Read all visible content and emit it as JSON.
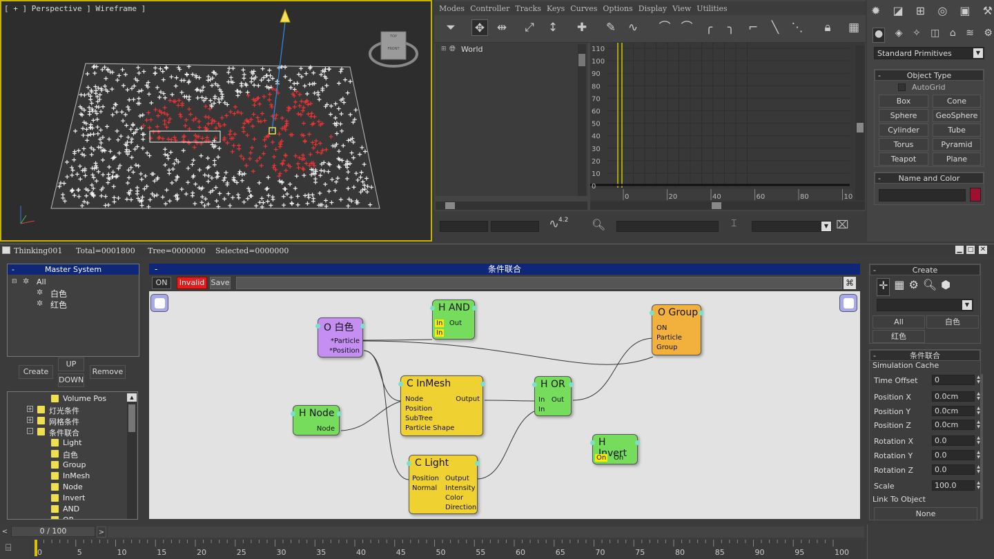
{
  "viewport": {
    "label": "[ + ] Perspective ] Wireframe ]",
    "viewcube_top": "TOP",
    "viewcube_front": "FRONT"
  },
  "trackview": {
    "menu": [
      "Modes",
      "Controller",
      "Tracks",
      "Keys",
      "Curves",
      "Options",
      "Display",
      "View",
      "Utilities"
    ],
    "tree_root": "World",
    "y_ticks": [
      "110",
      "100",
      "90",
      "80",
      "70",
      "60",
      "50",
      "40",
      "30",
      "20",
      "10",
      "0"
    ],
    "x_ticks": [
      "0",
      "20",
      "40",
      "60",
      "80",
      "10"
    ],
    "curve_badge": "4.2"
  },
  "cmdpanel": {
    "dropdown": "Standard Primitives",
    "object_type_title": "Object Type",
    "autogrid": "AutoGrid",
    "buttons": [
      "Box",
      "Cone",
      "Sphere",
      "GeoSphere",
      "Cylinder",
      "Tube",
      "Torus",
      "Pyramid",
      "Teapot",
      "Plane"
    ],
    "name_color_title": "Name and Color",
    "swatch_color": "#9e1030"
  },
  "thinking": {
    "title": "Thinking001",
    "total": "Total=0001800",
    "tree": "Tree=0000000",
    "selected": "Selected=0000000"
  },
  "master": {
    "title": "Master System",
    "items": [
      "All",
      "白色",
      "红色"
    ],
    "create": "Create",
    "up": "UP",
    "down": "DOWN",
    "remove": "Remove"
  },
  "master_tree": {
    "items": [
      {
        "label": "Volume Pos",
        "level": 2
      },
      {
        "label": "灯光条件",
        "level": 1,
        "toggle": "+"
      },
      {
        "label": "网格条件",
        "level": 1,
        "toggle": "+"
      },
      {
        "label": "条件联合",
        "level": 1,
        "toggle": "-"
      },
      {
        "label": "Light",
        "level": 2
      },
      {
        "label": "白色",
        "level": 2
      },
      {
        "label": "Group",
        "level": 2
      },
      {
        "label": "InMesh",
        "level": 2
      },
      {
        "label": "Node",
        "level": 2
      },
      {
        "label": "Invert",
        "level": 2
      },
      {
        "label": "AND",
        "level": 2
      },
      {
        "label": "OR",
        "level": 2
      }
    ]
  },
  "canvas": {
    "title": "条件联合",
    "on_label": "ON",
    "invalid_label": "Invalid",
    "save_label": "Save",
    "nodes": {
      "white": {
        "title": "O 白色",
        "ports": [
          "*Particle",
          "*Position"
        ]
      },
      "and": {
        "title": "H AND",
        "in1": "In",
        "in2": "In",
        "out": "Out"
      },
      "group": {
        "title": "O Group",
        "ports": [
          "ON",
          "Particle",
          "Group"
        ]
      },
      "inmesh": {
        "title": "C InMesh",
        "ports": [
          "Node",
          "Position",
          "SubTree",
          "Particle Shape"
        ],
        "out": "Output"
      },
      "hor": {
        "title": "H OR",
        "in1": "In",
        "in2": "In",
        "out": "Out"
      },
      "hnode": {
        "title": "H Node",
        "out": "Node"
      },
      "light": {
        "title": "C Light",
        "ins": [
          "Position",
          "Normal"
        ],
        "outs": [
          "Output",
          "Intensity",
          "Color",
          "Direction"
        ]
      },
      "invert": {
        "title": "H Invert",
        "in": "On",
        "out": "On"
      }
    }
  },
  "rightpanel": {
    "create_title": "Create",
    "tabs": [
      "All",
      "白色",
      "红色"
    ],
    "section_title": "条件联合",
    "group_title": "Simulation Cache",
    "props": [
      {
        "label": "Time Offset",
        "value": "0"
      },
      {
        "label": "Position X",
        "value": "0.0cm"
      },
      {
        "label": "Position Y",
        "value": "0.0cm"
      },
      {
        "label": "Position Z",
        "value": "0.0cm"
      },
      {
        "label": "Rotation X",
        "value": "0.0"
      },
      {
        "label": "Rotation Y",
        "value": "0.0"
      },
      {
        "label": "Rotation Z",
        "value": "0.0"
      },
      {
        "label": "Scale",
        "value": "100.0"
      }
    ],
    "link_label": "Link To Object",
    "link_value": "None"
  },
  "timeline": {
    "frame": "0 / 100",
    "ticks": [
      "0",
      "5",
      "10",
      "15",
      "20",
      "25",
      "30",
      "35",
      "40",
      "45",
      "50",
      "55",
      "60",
      "65",
      "70",
      "75",
      "80",
      "85",
      "90",
      "95",
      "100"
    ]
  }
}
